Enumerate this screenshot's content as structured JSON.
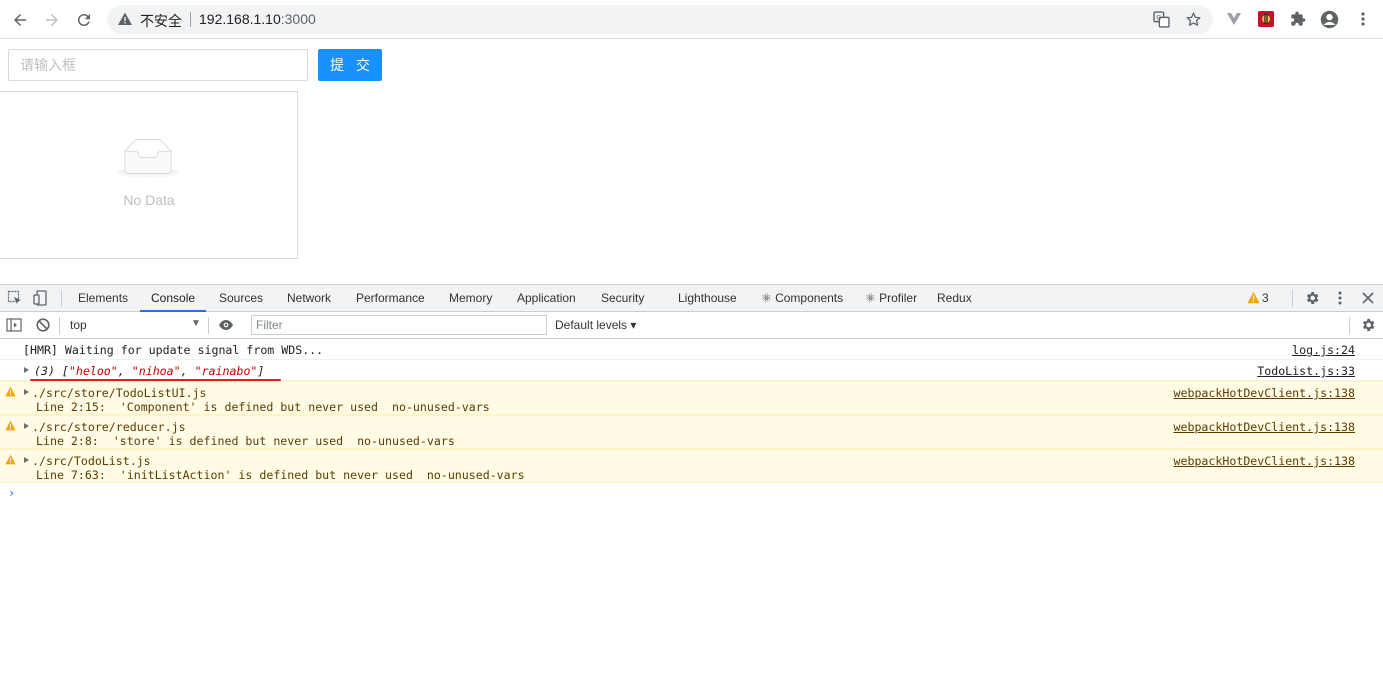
{
  "browser": {
    "security_label": "不安全",
    "url_host": "192.168.1.10",
    "url_port": ":3000"
  },
  "page": {
    "input_placeholder": "请输入框",
    "submit_label": "提 交",
    "empty_text": "No Data"
  },
  "devtools": {
    "tabs": [
      "Elements",
      "Console",
      "Sources",
      "Network",
      "Performance",
      "Memory",
      "Application",
      "Security",
      "Lighthouse",
      "⚛ Components",
      "⚛ Profiler",
      "Redux"
    ],
    "active_tab": "Console",
    "warning_count": "3",
    "context": "top",
    "filter_placeholder": "Filter",
    "levels_label": "Default levels ▾",
    "messages": [
      {
        "type": "log",
        "text": "[HMR] Waiting for update signal from WDS...",
        "source": "log.js:24"
      },
      {
        "type": "log-array",
        "prefix": "(3) [",
        "items": [
          "\"heloo\"",
          "\"nihoa\"",
          "\"rainabo\""
        ],
        "suffix": "]",
        "source": "TodoList.js:33"
      },
      {
        "type": "warn",
        "text": "./src/store/TodoListUI.js",
        "detail": "Line 2:15:  'Component' is defined but never used  no-unused-vars",
        "source": "webpackHotDevClient.js:138"
      },
      {
        "type": "warn",
        "text": "./src/store/reducer.js",
        "detail": "Line 2:8:  'store' is defined but never used  no-unused-vars",
        "source": "webpackHotDevClient.js:138"
      },
      {
        "type": "warn",
        "text": "./src/TodoList.js",
        "detail": "Line 7:63:  'initListAction' is defined but never used  no-unused-vars",
        "source": "webpackHotDevClient.js:138"
      }
    ],
    "prompt_symbol": "›"
  },
  "colors": {
    "primary_button": "#1890ff",
    "warning_bg": "#fffbe5",
    "string_red": "#c80000",
    "annotation_red": "#e02020",
    "active_tab_underline": "#1a73e8"
  }
}
